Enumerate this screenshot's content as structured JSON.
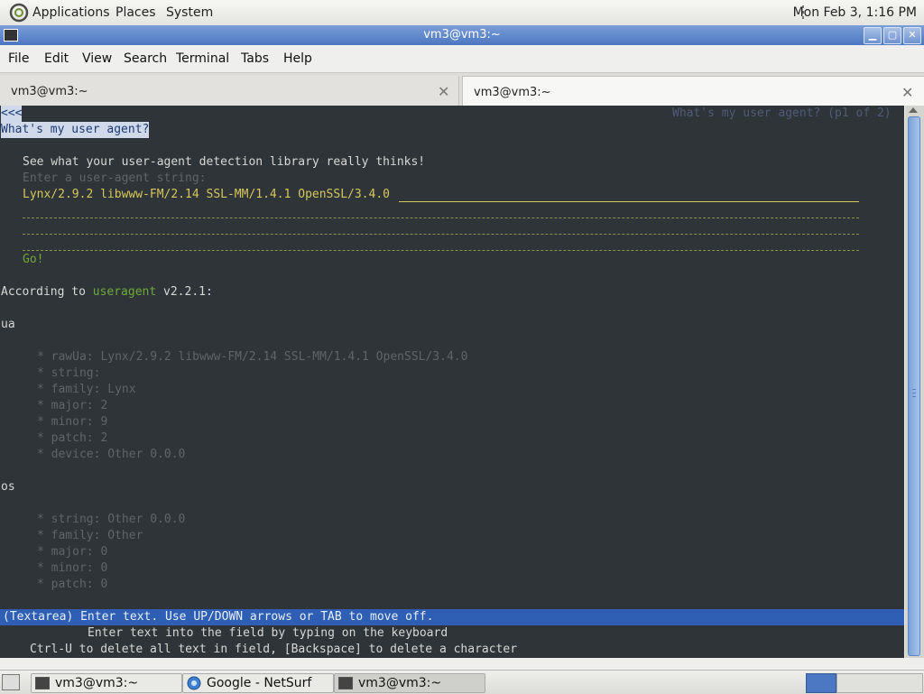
{
  "top_panel": {
    "menus": [
      "Applications",
      "Places",
      "System"
    ],
    "clock": "Mon Feb  3,  1:16 PM"
  },
  "window": {
    "title": "vm3@vm3:~",
    "menubar": [
      "File",
      "Edit",
      "View",
      "Search",
      "Terminal",
      "Tabs",
      "Help"
    ],
    "tabs": [
      {
        "label": "vm3@vm3:~",
        "close": "✕"
      },
      {
        "label": "vm3@vm3:~",
        "close": "✕"
      }
    ]
  },
  "terminal": {
    "back_link": "<<<",
    "page_info": "What's my user agent? (p1 of 2)",
    "heading": "What's my user agent?",
    "intro": "See what your user-agent detection library really thinks!",
    "field_label": "Enter a user-agent string:",
    "field_value": "Lynx/2.9.2 libwww-FM/2.14 SSL-MM/1.4.1 OpenSSL/3.4.0",
    "go_button": "Go!",
    "according_prefix": "According to ",
    "according_link": "useragent",
    "according_suffix": " v2.2.1:",
    "ua_heading": "ua",
    "ua_items": [
      "* rawUa: Lynx/2.9.2 libwww-FM/2.14 SSL-MM/1.4.1 OpenSSL/3.4.0",
      "* string:",
      "* family: Lynx",
      "* major: 2",
      "* minor: 9",
      "* patch: 2",
      "* device: Other 0.0.0"
    ],
    "os_heading": "os",
    "os_items": [
      "* string: Other 0.0.0",
      "* family: Other",
      "* major: 0",
      "* minor: 0",
      "* patch: 0"
    ],
    "status_line": "(Textarea) Enter text. Use UP/DOWN arrows or TAB to move off.",
    "help_line1": "Enter text into the field by typing on the keyboard",
    "help_line2": "Ctrl-U to delete all text in field, [Backspace] to delete a character"
  },
  "taskbar": {
    "tasks": [
      "vm3@vm3:~",
      "Google - NetSurf",
      "vm3@vm3:~"
    ]
  }
}
